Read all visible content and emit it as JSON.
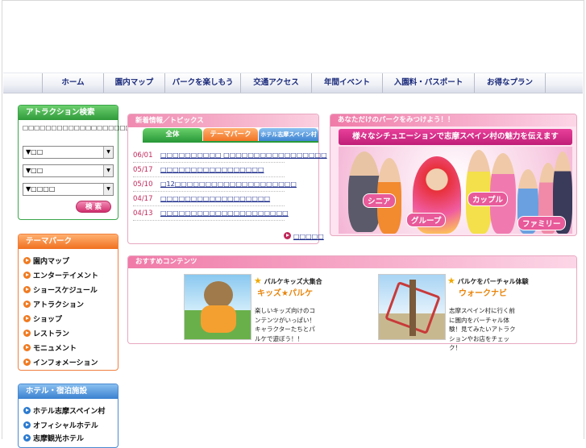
{
  "nav": [
    "ホーム",
    "園内マップ",
    "パークを楽しもう",
    "交通アクセス",
    "年間イベント",
    "入園料・パスポート",
    "お得なプラン"
  ],
  "attraction_search": {
    "title": "アトラクション検索",
    "description": "□□□□□□□□□□□□□□□□□□□□□□□□□□□□□□□□",
    "selects": [
      "▼□□",
      "▼□□",
      "▼□□□□"
    ],
    "search_label": "検 索"
  },
  "theme_park": {
    "title": "テーマパーク",
    "items": [
      "園内マップ",
      "エンターテイメント",
      "ショースケジュール",
      "アトラクション",
      "ショップ",
      "レストラン",
      "モニュメント",
      "インフォメーション"
    ]
  },
  "hotels": {
    "title": "ホテル・宿泊施設",
    "items": [
      "ホテル志摩スペイン村",
      "オフィシャルホテル",
      "志摩観光ホテル"
    ]
  },
  "news": {
    "title": "新着情報／トピックス",
    "tabs": [
      "全体",
      "テーマパーク",
      "ホテル志摩スペイン村"
    ],
    "items": [
      {
        "date": "06/01",
        "text": "□□□□□□□□□□ □□□□□□□□□□□□□□□□□"
      },
      {
        "date": "05/17",
        "text": "□□□□□□□□□□□□□□□□□"
      },
      {
        "date": "05/10",
        "text": "□12□□□□□□□□□□□□□□□□□□□□"
      },
      {
        "date": "04/17",
        "text": "□□□□□□□□□□□□□□□□□□"
      },
      {
        "date": "04/13",
        "text": "□□□□□□□□□□□□□□□□□□□□□"
      }
    ],
    "more": "□□□□□"
  },
  "find_park": {
    "title": "あなただけのパークをみつけよう！！",
    "banner": "様々なシチュエーションで志摩スペイン村の魅力を伝えます",
    "categories": [
      "シニア",
      "グループ",
      "カップル",
      "ファミリー"
    ]
  },
  "recommended": {
    "title": "おすすめコンテンツ",
    "items": [
      {
        "title": "パルケキッズ大集合",
        "subtitle": "キッズ★パルケ",
        "text": "楽しいキッズ向けのコンテンツがいっぱい！キャラクターたちとパルケで遊ぼう！！"
      },
      {
        "title": "パルケをバーチャル体験",
        "subtitle": "ウォークナビ",
        "text": "志摩スペイン村に行く前に園内をバーチャル体験！見てみたいアトラクションやお店をチェック！"
      }
    ]
  }
}
